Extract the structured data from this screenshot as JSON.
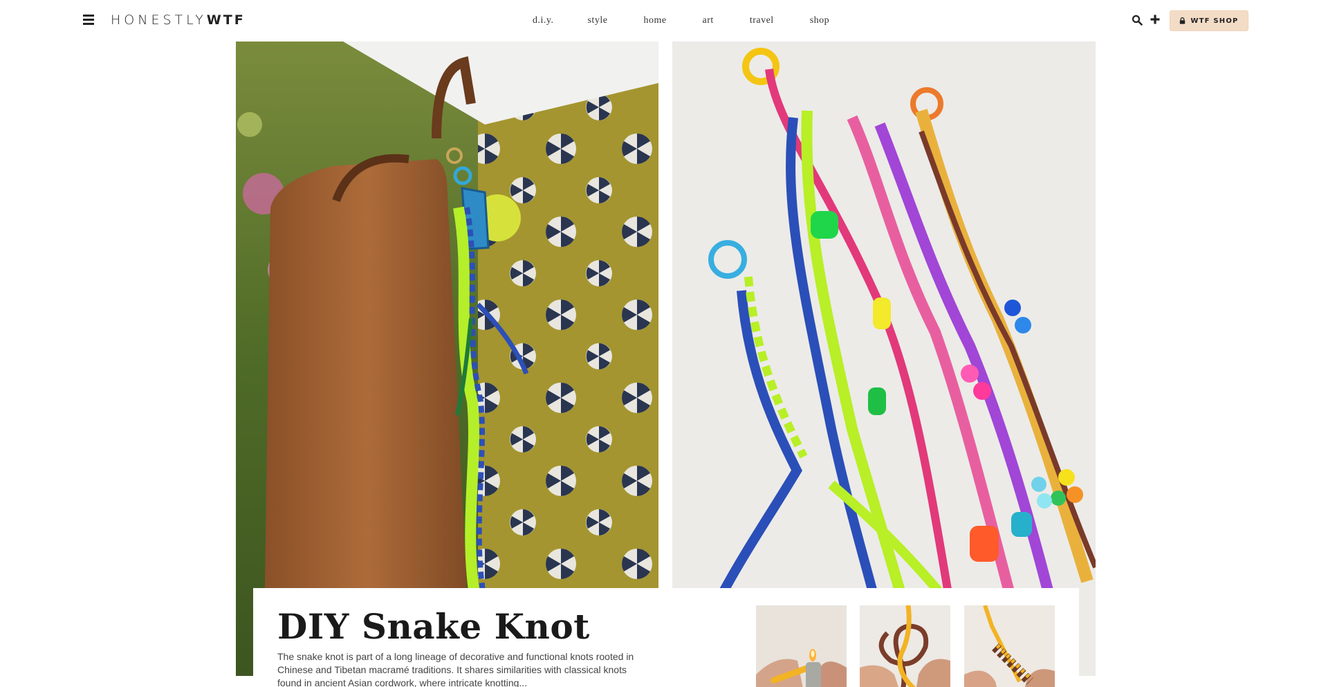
{
  "header": {
    "logo_light": "HONESTLY",
    "logo_bold": "WTF",
    "nav": [
      {
        "label": "d.i.y."
      },
      {
        "label": "style"
      },
      {
        "label": "home"
      },
      {
        "label": "art"
      },
      {
        "label": "travel"
      },
      {
        "label": "shop"
      }
    ],
    "shop_button": "WTF SHOP",
    "icons": [
      "hamburger-menu-icon",
      "search-icon",
      "plus-icon",
      "lock-icon"
    ]
  },
  "article": {
    "title": "DIY Snake Knot",
    "excerpt": "The snake knot is part of a long lineage of decorative and functional knots rooted in Chinese and Tibetan macramé traditions. It shares similarities with classical knots found in ancient Asian cordwork, where intricate knotting..."
  },
  "colors": {
    "shop_button_bg": "#f3dcc6",
    "text": "#222222",
    "background": "#ffffff"
  }
}
